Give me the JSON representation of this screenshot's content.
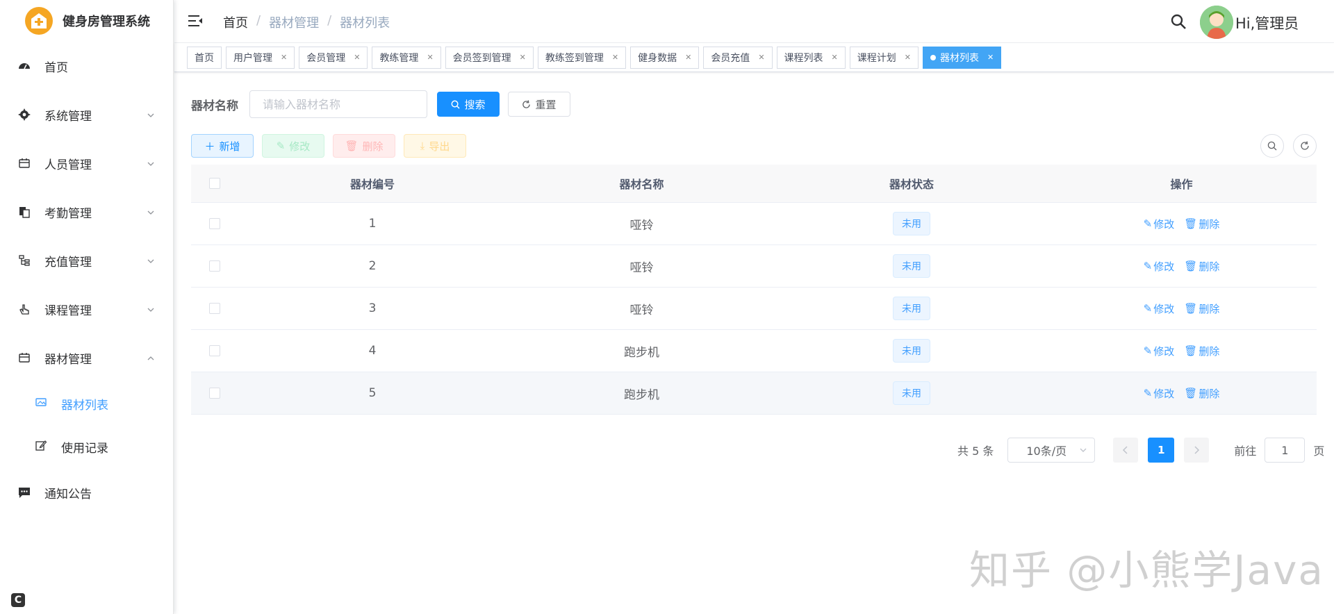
{
  "app": {
    "title": "健身房管理系统"
  },
  "sidebar": {
    "items": [
      {
        "label": "首页",
        "icon": "dashboard-icon",
        "expandable": false
      },
      {
        "label": "系统管理",
        "icon": "gear-icon",
        "expandable": true
      },
      {
        "label": "人员管理",
        "icon": "people-icon",
        "expandable": true
      },
      {
        "label": "考勤管理",
        "icon": "clipboard-icon",
        "expandable": true
      },
      {
        "label": "充值管理",
        "icon": "tree-icon",
        "expandable": true
      },
      {
        "label": "课程管理",
        "icon": "hand-icon",
        "expandable": true
      },
      {
        "label": "器材管理",
        "icon": "calendar-icon",
        "expandable": true,
        "expanded": true
      }
    ],
    "subitems": [
      {
        "label": "器材列表",
        "icon": "image-icon",
        "active": true
      },
      {
        "label": "使用记录",
        "icon": "edit-icon",
        "active": false
      }
    ],
    "last": {
      "label": "通知公告",
      "icon": "message-icon"
    }
  },
  "header": {
    "breadcrumb": [
      "首页",
      "器材管理",
      "器材列表"
    ],
    "separator": "/",
    "greeting": "Hi,管理员"
  },
  "tags": [
    {
      "label": "首页",
      "closable": false
    },
    {
      "label": "用户管理",
      "closable": true
    },
    {
      "label": "会员管理",
      "closable": true
    },
    {
      "label": "教练管理",
      "closable": true
    },
    {
      "label": "会员签到管理",
      "closable": true
    },
    {
      "label": "教练签到管理",
      "closable": true
    },
    {
      "label": "健身数据",
      "closable": true
    },
    {
      "label": "会员充值",
      "closable": true
    },
    {
      "label": "课程列表",
      "closable": true
    },
    {
      "label": "课程计划",
      "closable": true
    },
    {
      "label": "器材列表",
      "closable": true,
      "active": true
    }
  ],
  "search": {
    "label": "器材名称",
    "placeholder": "请输入器材名称",
    "search_btn": "搜索",
    "reset_btn": "重置"
  },
  "toolbar": {
    "add": "新增",
    "edit": "修改",
    "delete": "删除",
    "export": "导出"
  },
  "table": {
    "columns": [
      "器材编号",
      "器材名称",
      "器材状态",
      "操作"
    ],
    "rows": [
      {
        "id": "1",
        "name": "哑铃",
        "status": "未用"
      },
      {
        "id": "2",
        "name": "哑铃",
        "status": "未用"
      },
      {
        "id": "3",
        "name": "哑铃",
        "status": "未用"
      },
      {
        "id": "4",
        "name": "跑步机",
        "status": "未用"
      },
      {
        "id": "5",
        "name": "跑步机",
        "status": "未用"
      }
    ],
    "op_edit": "修改",
    "op_delete": "删除"
  },
  "pagination": {
    "total_text": "共 5 条",
    "page_size": "10条/页",
    "current": "1",
    "goto_prefix": "前往",
    "goto_value": "1",
    "goto_suffix": "页"
  },
  "watermark": "知乎 @小熊学Java",
  "colors": {
    "primary": "#1890ff",
    "active_tag": "#42a5f5",
    "link": "#409eff",
    "logo": "#f5a623"
  }
}
